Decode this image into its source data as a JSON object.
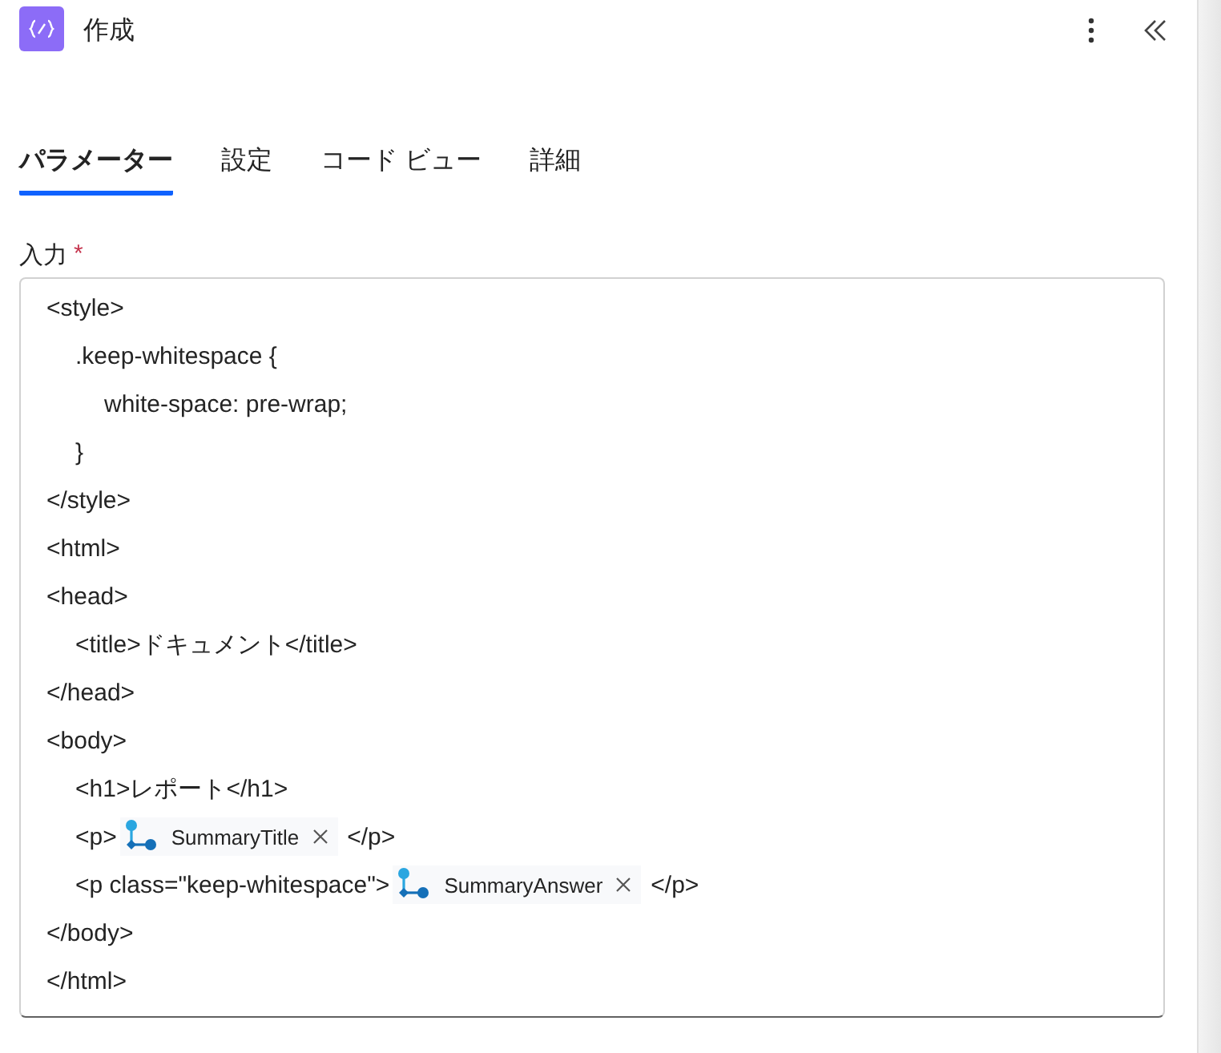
{
  "header": {
    "title": "作成"
  },
  "tabs": [
    {
      "label": "パラメーター",
      "selected": true
    },
    {
      "label": "設定",
      "selected": false
    },
    {
      "label": "コード ビュー",
      "selected": false
    },
    {
      "label": "詳細",
      "selected": false
    }
  ],
  "field": {
    "label": "入力",
    "required_mark": "*",
    "lines": [
      {
        "parts": [
          {
            "kind": "text",
            "text": "<style>"
          }
        ],
        "children": [
          {
            "parts": [
              {
                "kind": "text",
                "text": ".keep-whitespace {"
              }
            ],
            "children": [
              {
                "parts": [
                  {
                    "kind": "text",
                    "text": "white-space: pre-wrap;"
                  }
                ]
              }
            ]
          },
          {
            "parts": [
              {
                "kind": "text",
                "text": "}"
              }
            ]
          }
        ]
      },
      {
        "parts": [
          {
            "kind": "text",
            "text": "</style>"
          }
        ]
      },
      {
        "parts": [
          {
            "kind": "text",
            "text": "<html>"
          }
        ]
      },
      {
        "parts": [
          {
            "kind": "text",
            "text": "<head>"
          }
        ],
        "children": [
          {
            "parts": [
              {
                "kind": "text",
                "text": "<title>ドキュメント</title>"
              }
            ]
          }
        ]
      },
      {
        "parts": [
          {
            "kind": "text",
            "text": "</head>"
          }
        ]
      },
      {
        "parts": [
          {
            "kind": "text",
            "text": "<body>"
          }
        ],
        "children": [
          {
            "parts": [
              {
                "kind": "text",
                "text": "<h1>レポート</h1>"
              }
            ]
          },
          {
            "parts": [
              {
                "kind": "text",
                "text": "<p>"
              },
              {
                "kind": "token",
                "label": "SummaryTitle"
              },
              {
                "kind": "text",
                "text": "</p>"
              }
            ]
          },
          {
            "parts": [
              {
                "kind": "text",
                "text": "<p class=\"keep-whitespace\">"
              },
              {
                "kind": "token",
                "label": "SummaryAnswer"
              },
              {
                "kind": "text",
                "text": "</p>"
              }
            ]
          }
        ]
      },
      {
        "parts": [
          {
            "kind": "text",
            "text": "</body>"
          }
        ]
      },
      {
        "parts": [
          {
            "kind": "text",
            "text": "</html>"
          }
        ]
      }
    ]
  }
}
